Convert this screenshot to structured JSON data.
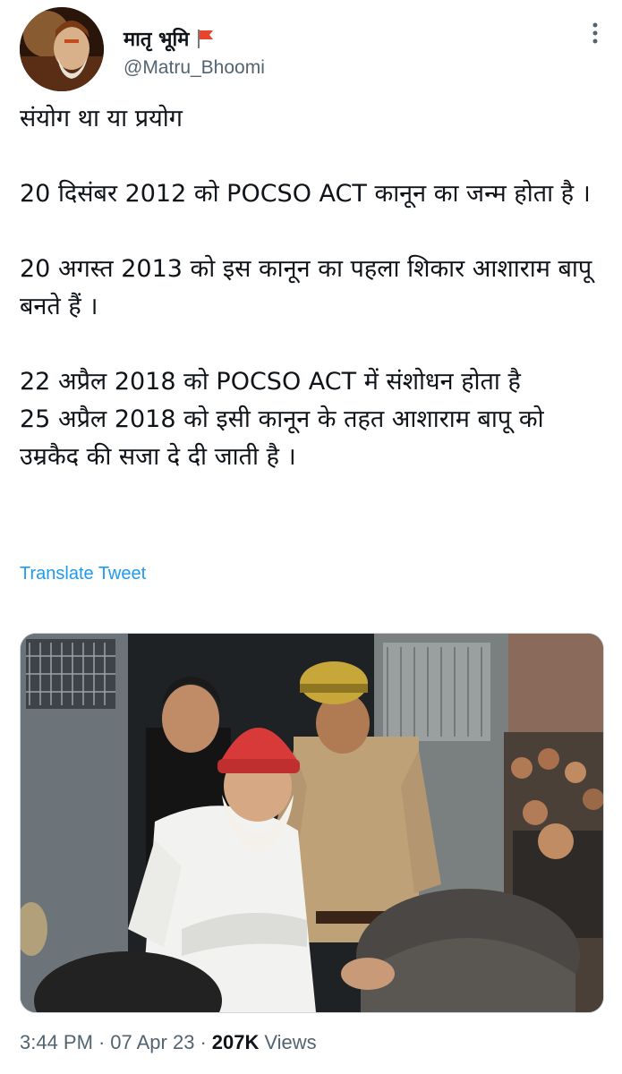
{
  "user": {
    "display_name": "मातृ भूमि",
    "handle": "@Matru_Bhoomi"
  },
  "tweet": {
    "text": "संयोग था या प्रयोग\n\n20 दिसंबर 2012 को POCSO ACT कानून का जन्म होता है ।\n\n20 अगस्त 2013 को इस कानून का पहला शिकार आशाराम बापू बनते हैं ।\n\n22 अप्रैल 2018 को POCSO ACT में संशोधन होता है\n25 अप्रैल 2018 को इसी कानून के तहत आशाराम बापू को उम्रकैद की सजा दे दी जाती है ।",
    "translate_label": "Translate Tweet"
  },
  "meta": {
    "time": "3:44 PM",
    "separator": "·",
    "date": "07 Apr 23",
    "views_count": "207K",
    "views_label": "Views"
  },
  "icons": {
    "flag": "flag-icon",
    "more": "more-options-icon"
  },
  "colors": {
    "link": "#1d9bf0",
    "secondary_text": "#536471",
    "flag": "#e8452c"
  }
}
